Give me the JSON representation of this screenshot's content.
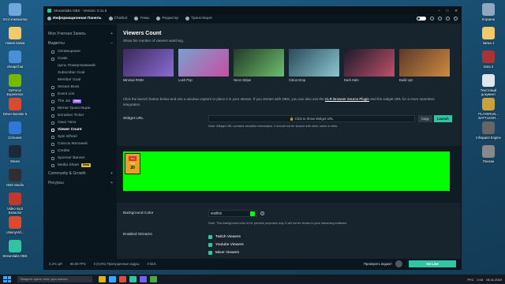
{
  "desktop": {
    "icons_left": [
      {
        "label": "Этот компьютер",
        "color": "#6fa8dc"
      },
      {
        "label": "Новая папка",
        "color": "#f3c969"
      },
      {
        "label": "cheapChat",
        "color": "#4a90d9"
      },
      {
        "label": "GeForce Experience",
        "color": "#76b900"
      },
      {
        "label": "Driver Booster 6",
        "color": "#d94a2f"
      },
      {
        "label": "CCleaner",
        "color": "#2f77d9"
      },
      {
        "label": "Steam",
        "color": "#1b2838"
      },
      {
        "label": "OBS Studio",
        "color": "#302e31"
      },
      {
        "label": "Video mp3 Extractor",
        "color": "#c0392b"
      },
      {
        "label": "UnionyVid...",
        "color": "#d94a2f"
      },
      {
        "label": "Streamlabs OBS",
        "color": "#31c3a2"
      }
    ],
    "icons_right": [
      {
        "label": "Корзина",
        "color": "#8fa8c0"
      },
      {
        "label": "папка 1",
        "color": "#f3c969"
      },
      {
        "label": "Dota 2",
        "color": "#a33"
      },
      {
        "label": "Текстовый документ",
        "color": "#dfe6ee"
      },
      {
        "label": "PLAYERUN... BATTLEGR...",
        "color": "#c9a23a"
      },
      {
        "label": "Infrapaint Engine",
        "color": "#666"
      },
      {
        "label": "Поиски",
        "color": "#888"
      }
    ]
  },
  "taskbar": {
    "search_placeholder": "Введите здесь текст для поиска",
    "lang": "РУС",
    "time": "0:16",
    "date": "06.11.2019",
    "apps": [
      "#e0b400",
      "#3ea6ff",
      "#e34a3a",
      "#31c3a2",
      "#7a5cff",
      "#4aa84a"
    ]
  },
  "window": {
    "title": "Streamlabs OBS - Version: 0.11.5",
    "nav": [
      {
        "label": "Информационная Панель",
        "active": true
      },
      {
        "label": "Chatbot",
        "active": false
      },
      {
        "label": "Темы",
        "active": false
      },
      {
        "label": "Редактор",
        "active": false
      },
      {
        "label": "Трансляция",
        "active": false
      }
    ]
  },
  "sidebar": {
    "account": "Моя Учетная Запись",
    "widgets": "Виджеты",
    "items": [
      {
        "label": "Оповещения",
        "sub": false,
        "active": false
      },
      {
        "label": "Goals",
        "sub": false,
        "active": false
      },
      {
        "label": "Цель Пожертвований",
        "sub": true,
        "active": false
      },
      {
        "label": "Subscriber Goal",
        "sub": true,
        "active": false
      },
      {
        "label": "Member Goal",
        "sub": true,
        "active": false
      },
      {
        "label": "Stream Boss",
        "sub": false,
        "active": false
      },
      {
        "label": "Event List",
        "sub": false,
        "active": false
      },
      {
        "label": "The Jar",
        "sub": false,
        "active": false,
        "badge": "New"
      },
      {
        "label": "Метки Трансляции",
        "sub": false,
        "active": false
      },
      {
        "label": "Donation Ticker",
        "sub": false,
        "active": false
      },
      {
        "label": "Окно Чата",
        "sub": false,
        "active": false
      },
      {
        "label": "Viewer Count",
        "sub": false,
        "active": true
      },
      {
        "label": "Spin Wheel",
        "sub": false,
        "active": false
      },
      {
        "label": "Список Желаний",
        "sub": false,
        "active": false
      },
      {
        "label": "Credits",
        "sub": false,
        "active": false
      },
      {
        "label": "Sponsor Banner",
        "sub": false,
        "active": false
      },
      {
        "label": "Media Share",
        "sub": false,
        "active": false,
        "badge": "Beta"
      }
    ],
    "community": "Community & Growth",
    "resources": "Ресурсы"
  },
  "content": {
    "title": "Viewers Count",
    "subtitle": "Show the number of viewers watching.",
    "thumbs": [
      {
        "caption": "Minimal RGB+",
        "c1": "#3a2a5a",
        "c2": "#8b6bd6"
      },
      {
        "caption": "Lush Pop",
        "c1": "#7aa0d0",
        "c2": "#c84fa0"
      },
      {
        "caption": "Neon Stripe",
        "c1": "#243a2a",
        "c2": "#6cbf6a"
      },
      {
        "caption": "Citrus Drop",
        "c1": "#2a4a5a",
        "c2": "#8ac8d0"
      },
      {
        "caption": "Dark Halo",
        "c1": "#1a1a2a",
        "c2": "#c0506a"
      },
      {
        "caption": "Build Up!",
        "c1": "#5a3a2a",
        "c2": "#d08a40"
      }
    ],
    "info_pre": "Click the launch button below and use a window capture to place it in your stream. If you stream with OBS, you can also use the",
    "info_link": "CLR Browser Source Plugin",
    "info_post": "and the widget URL for a more seamless integration.",
    "widget_url_label": "Widget URL",
    "widget_url_field": "🔒 Click to Show Widget URL",
    "copy": "Copy",
    "launch": "Launch",
    "url_note": "Note: Widget URL contains sensitive information. It should not be shared with other users or sites.",
    "widget_count": "20",
    "widget_logo": "You Tube",
    "bg_color_label": "Background Color",
    "bg_color_value": "#00ff00",
    "bg_color_hex": "#00ff00",
    "help_glyph": "?",
    "bg_note": "Note: This background color is for preview purposes only. It will not be shown in your streaming software.",
    "enabled_streams_label": "Enabled Streams",
    "streams": [
      "Twitch Viewers",
      "Youtube Viewers",
      "Mixer Viewers"
    ]
  },
  "status": {
    "cpu": "2,3% ЦП",
    "fps": "60,00 FPS",
    "dropped": "0 (0,0%) Пропущенные кадры",
    "kbs": "0 kb/s",
    "test": "Проверить виджет",
    "go_live": "Go Live"
  },
  "colors": {
    "accent": "#31c3a2",
    "green_screen": "#00ff00"
  }
}
